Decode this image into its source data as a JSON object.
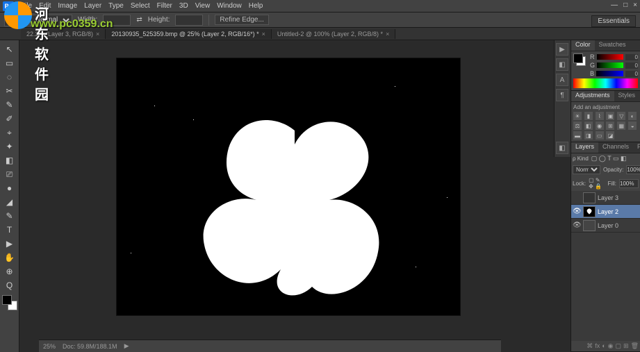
{
  "watermark": {
    "text1": "河东软件园",
    "text2": "www.pc0359.cn"
  },
  "menubar": {
    "logo": "Ps",
    "items": [
      "File",
      "Edit",
      "Image",
      "Layer",
      "Type",
      "Select",
      "Filter",
      "3D",
      "View",
      "Window",
      "Help"
    ]
  },
  "window_controls": {
    "min": "—",
    "max": "□",
    "close": "×"
  },
  "optionsbar": {
    "mode_label": "Normal",
    "width_label": "Width:",
    "height_label": "Height:",
    "refine_edge": "Refine Edge...",
    "workspace": "Essentials"
  },
  "tabs": [
    {
      "label": "22.2% (Layer 3, RGB/8)",
      "active": false
    },
    {
      "label": "20130935_525359.bmp @ 25% (Layer 2, RGB/16*) *",
      "active": true
    },
    {
      "label": "Untitled-2 @ 100% (Layer 2, RGB/8) *",
      "active": false
    }
  ],
  "toolbar_tools": [
    "↖",
    "▭",
    "◌",
    "✂",
    "✎",
    "✐",
    "⌖",
    "✦",
    "◧",
    "⎚",
    "●",
    "◢",
    "✎",
    "T",
    "▶",
    "✋",
    "⊕",
    "Q"
  ],
  "statusbar": {
    "zoom": "25%",
    "doc": "Doc: 59.8M/188.1M"
  },
  "color_panel": {
    "tabs": [
      "Color",
      "Swatches"
    ],
    "r": 0,
    "g": 0,
    "b": 0
  },
  "adjustments_panel": {
    "tabs": [
      "Adjustments",
      "Styles"
    ],
    "hint": "Add an adjustment"
  },
  "layers_panel": {
    "tabs": [
      "Layers",
      "Channels",
      "Paths"
    ],
    "kind_label": "ρ Kind",
    "blend_label": "Normal",
    "opacity_label": "Opacity:",
    "opacity_val": "100%",
    "lock_label": "Lock:",
    "fill_label": "Fill:",
    "fill_val": "100%",
    "layers": [
      {
        "name": "Layer 3",
        "visible": false,
        "active": false
      },
      {
        "name": "Layer 2",
        "visible": true,
        "active": true
      },
      {
        "name": "Layer 0",
        "visible": true,
        "active": false
      }
    ]
  }
}
